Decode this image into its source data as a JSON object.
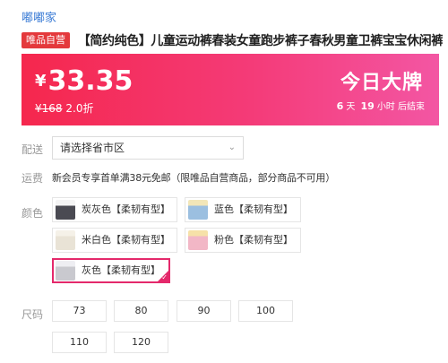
{
  "shop_name": "嘟嘟家",
  "badge": "唯品自营",
  "title": "【简约纯色】儿童运动裤春装女童跑步裤子春秋男童卫裤宝宝休闲裤",
  "price": {
    "currency": "¥",
    "current": "33.35",
    "original": "¥168",
    "discount": "2.0折",
    "deal_name": "今日大牌",
    "countdown": {
      "days": "6",
      "days_unit": "天",
      "hours": "19",
      "hours_unit": "小时",
      "suffix": "后结束"
    }
  },
  "delivery": {
    "label": "配送",
    "placeholder": "请选择省市区"
  },
  "shipping": {
    "label": "运费",
    "text": "新会员专享首单满38元免邮（限唯品自营商品，部分商品不可用）"
  },
  "colors": {
    "label": "颜色",
    "options": [
      {
        "name": "炭灰色【柔韧有型】",
        "swatch": "#4a4a52",
        "selected": false
      },
      {
        "name": "蓝色【柔韧有型】",
        "swatch": "#9bbfe0",
        "selected": false
      },
      {
        "name": "米白色【柔韧有型】",
        "swatch": "#e9e3d6",
        "selected": false
      },
      {
        "name": "粉色【柔韧有型】",
        "swatch": "#f2b7c6",
        "selected": false
      },
      {
        "name": "灰色【柔韧有型】",
        "swatch": "#c9c9cf",
        "selected": true
      }
    ]
  },
  "sizes": {
    "label": "尺码",
    "options": [
      "73",
      "80",
      "90",
      "100",
      "110",
      "120"
    ]
  },
  "theme": {
    "accent": "#f43b78",
    "badge": "#e4393c",
    "selected_border": "#e4296b"
  }
}
